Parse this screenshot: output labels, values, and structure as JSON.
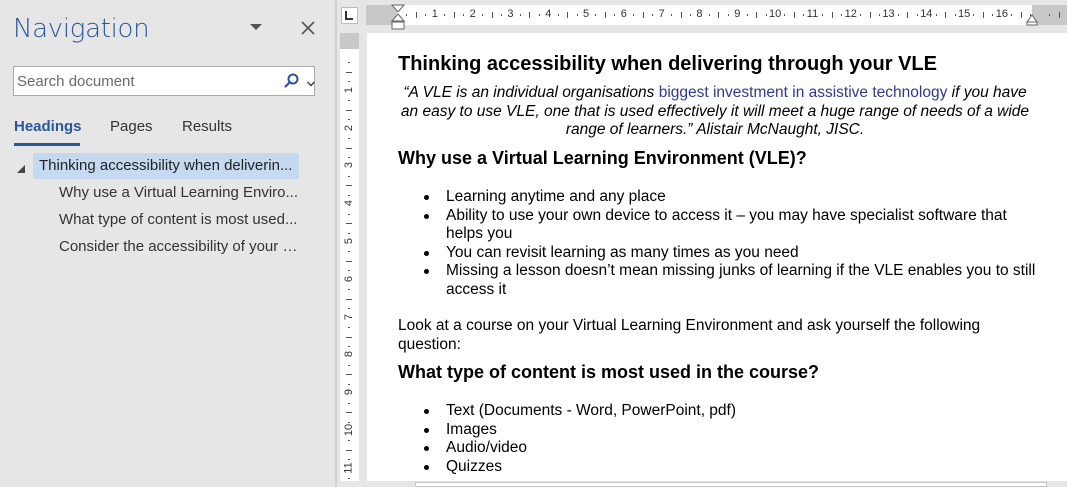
{
  "navigation": {
    "title": "Navigation",
    "search_placeholder": "Search document",
    "tabs": {
      "headings": "Headings",
      "pages": "Pages",
      "results": "Results"
    },
    "tree": [
      {
        "label": "Thinking accessibility when deliverin...",
        "level": 1,
        "selected": true
      },
      {
        "label": "Why use a Virtual Learning Enviro...",
        "level": 2
      },
      {
        "label": "What type of content is most used...",
        "level": 2
      },
      {
        "label": "Consider the accessibility of your r...",
        "level": 2
      }
    ]
  },
  "ruler": {
    "horizontal": [
      "1",
      "2",
      "3",
      "4",
      "5",
      "6",
      "7",
      "8",
      "9",
      "10",
      "11",
      "12",
      "13",
      "14",
      "15",
      "16"
    ],
    "vertical": [
      "1",
      "2",
      "3",
      "4",
      "5",
      "6",
      "7",
      "8",
      "9",
      "10",
      "11"
    ]
  },
  "document": {
    "title": "Thinking accessibility when delivering through your VLE",
    "quote_part1": "“A VLE is an individual organisations ",
    "quote_link": "biggest investment in assistive technology",
    "quote_part2": " if you have an easy to use VLE, one that is used effectively it will meet a huge range of needs of a wide range of learners.” Alistair McNaught, JISC.",
    "heading_why": "Why use a Virtual Learning Environment (VLE)?",
    "why_items": [
      "Learning anytime and any place",
      "Ability to use your own device to access it – you may have specialist software that helps you",
      "You can revisit learning as many times as you need",
      "Missing a lesson doesn’t mean missing junks of learning if the VLE enables you to still access it"
    ],
    "paragraph": "Look at a course on your Virtual Learning Environment and ask yourself the following question:",
    "heading_what": "What type of content is most used in the course?",
    "what_items": [
      "Text (Documents - Word, PowerPoint, pdf)",
      "Images",
      "Audio/video",
      "Quizzes"
    ]
  },
  "colors": {
    "accent": "#2b579a",
    "selection": "#c5d9f1",
    "link": "#2e3b8c"
  }
}
